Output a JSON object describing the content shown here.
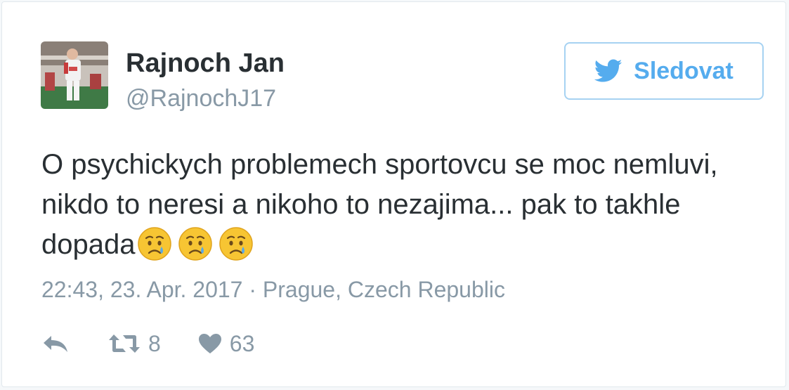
{
  "tweet": {
    "author_name": "Rajnoch Jan",
    "author_handle": "@RajnochJ17",
    "follow_label": "Sledovat",
    "text_line1": "O psychickych problemech sportovcu se moc nemluvi,",
    "text_line2": "nikdo to neresi a nikoho to nezajima... pak to takhle",
    "text_line3": "dopada",
    "emojis": [
      "crying-face-icon",
      "crying-face-icon",
      "crying-face-icon"
    ],
    "timestamp_location": "22:43, 23. Apr. 2017 · Prague, Czech Republic",
    "retweet_count": "8",
    "like_count": "63"
  },
  "icons": {
    "follow": "twitter-bird-icon",
    "reply": "reply-arrow-icon",
    "retweet": "retweet-icon",
    "like": "heart-icon"
  },
  "colors": {
    "accent": "#55acee",
    "text": "#292f33",
    "muted": "#8899a6",
    "border": "#e1e8ed"
  }
}
